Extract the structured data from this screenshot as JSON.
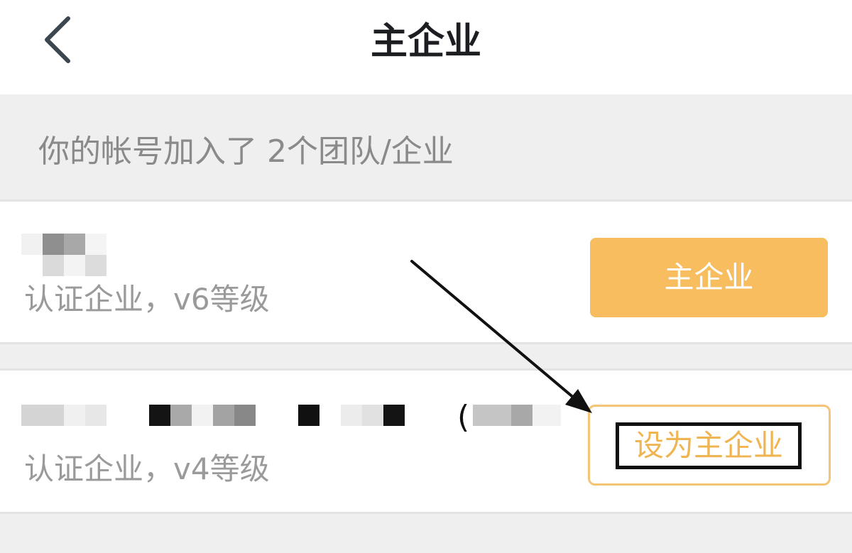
{
  "header": {
    "title": "主企业",
    "back_icon": "chevron-left-icon"
  },
  "summary": {
    "text": "你的帐号加入了 2个团队/企业"
  },
  "companies": [
    {
      "name_state": "blurred",
      "subtitle": "认证企业，v6等级",
      "action_label": "主企业"
    },
    {
      "name_state": "blurred",
      "paren": "(",
      "subtitle": "认证企业，v4等级",
      "action_label": "设为主企业"
    }
  ],
  "colors": {
    "accent": "#f7bd5f",
    "accent_text": "#f0b553",
    "title": "#1c1e21",
    "muted": "#9a9a9a"
  }
}
